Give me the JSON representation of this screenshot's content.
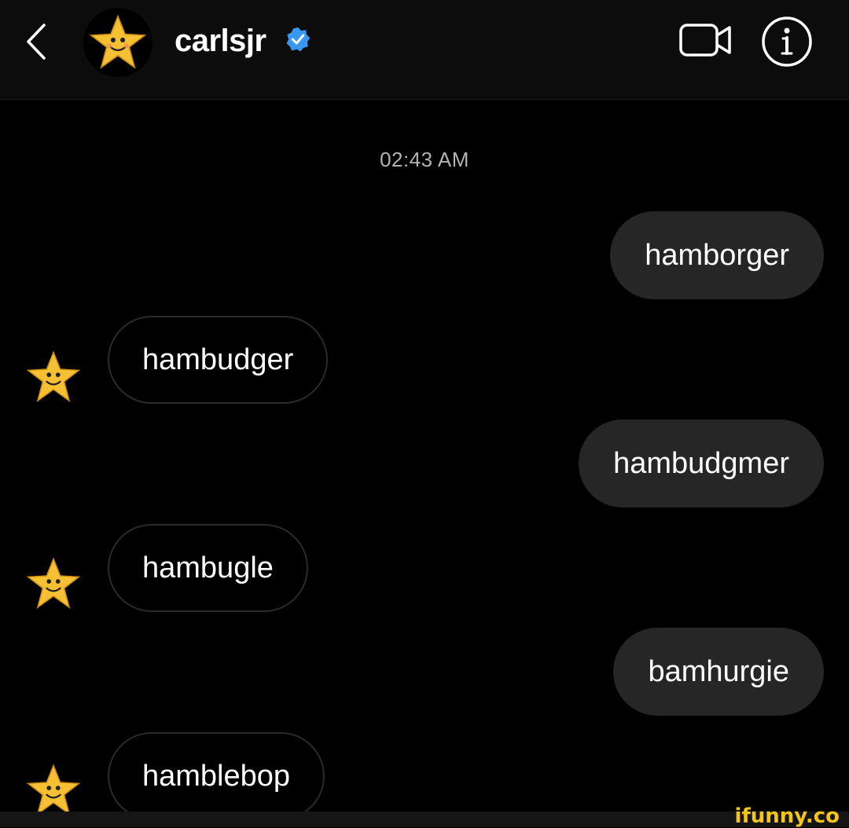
{
  "header": {
    "back_icon": "chevron-left-icon",
    "avatar_icon": "carls-jr-star-logo",
    "username": "carlsjr",
    "verified_icon": "verified-badge-icon",
    "video_call_icon": "video-camera-icon",
    "info_icon": "info-icon"
  },
  "thread": {
    "timestamp": "02:43 AM",
    "messages": [
      {
        "from": "me",
        "text": "hamborger"
      },
      {
        "from": "carlsjr",
        "text": "hambudger"
      },
      {
        "from": "me",
        "text": "hambudgmer"
      },
      {
        "from": "carlsjr",
        "text": "hambugle"
      },
      {
        "from": "me",
        "text": "bamhurgie"
      },
      {
        "from": "carlsjr",
        "text": "hamblebop"
      }
    ]
  },
  "watermark": "ifunny.co",
  "colors": {
    "background": "#000000",
    "header_bg": "#0c0c0c",
    "sent_bubble": "#262626",
    "received_border": "#2a2a2a",
    "verified_blue": "#3897f0",
    "star_yellow": "#f6c034"
  }
}
